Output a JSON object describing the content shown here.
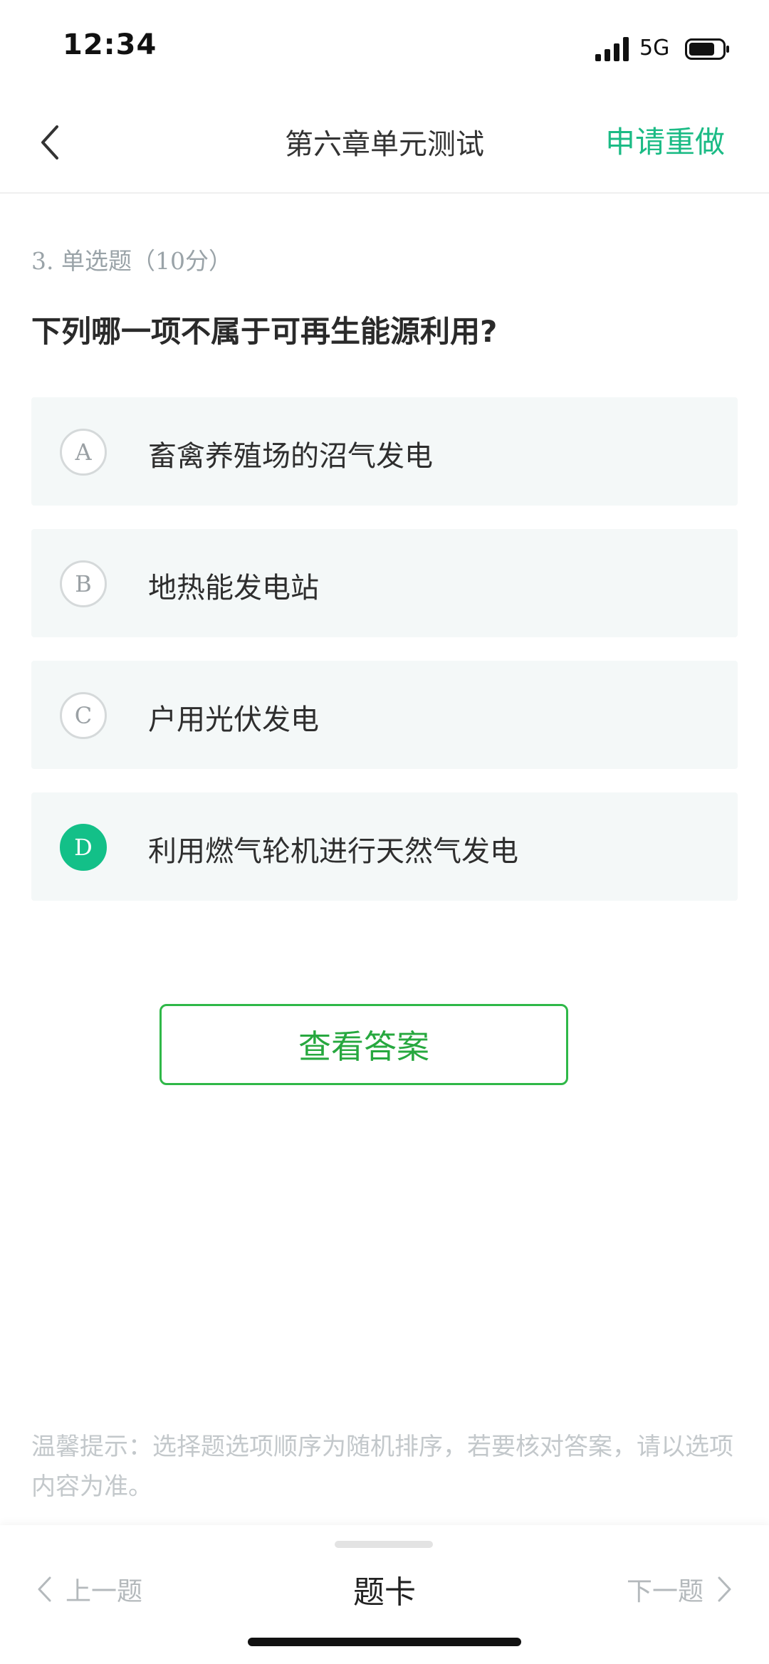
{
  "status_bar": {
    "time": "12:34",
    "network": "5G"
  },
  "header": {
    "title": "第六章单元测试",
    "action_label": "申请重做"
  },
  "question": {
    "meta": "3. 单选题（10分）",
    "text": "下列哪一项不属于可再生能源利用?",
    "options": [
      {
        "letter": "A",
        "text": "畜禽养殖场的沼气发电",
        "selected": false
      },
      {
        "letter": "B",
        "text": "地热能发电站",
        "selected": false
      },
      {
        "letter": "C",
        "text": "户用光伏发电",
        "selected": false
      },
      {
        "letter": "D",
        "text": "利用燃气轮机进行天然气发电",
        "selected": true
      }
    ]
  },
  "answer_button": "查看答案",
  "tip": "温馨提示：选择题选项顺序为随机排序，若要核对答案，请以选项内容为准。",
  "bottom_nav": {
    "prev": "上一题",
    "card": "题卡",
    "next": "下一题"
  },
  "colors": {
    "accent": "#1bbb85",
    "answer_green": "#27a83f",
    "option_bg": "#f4f8f8"
  }
}
